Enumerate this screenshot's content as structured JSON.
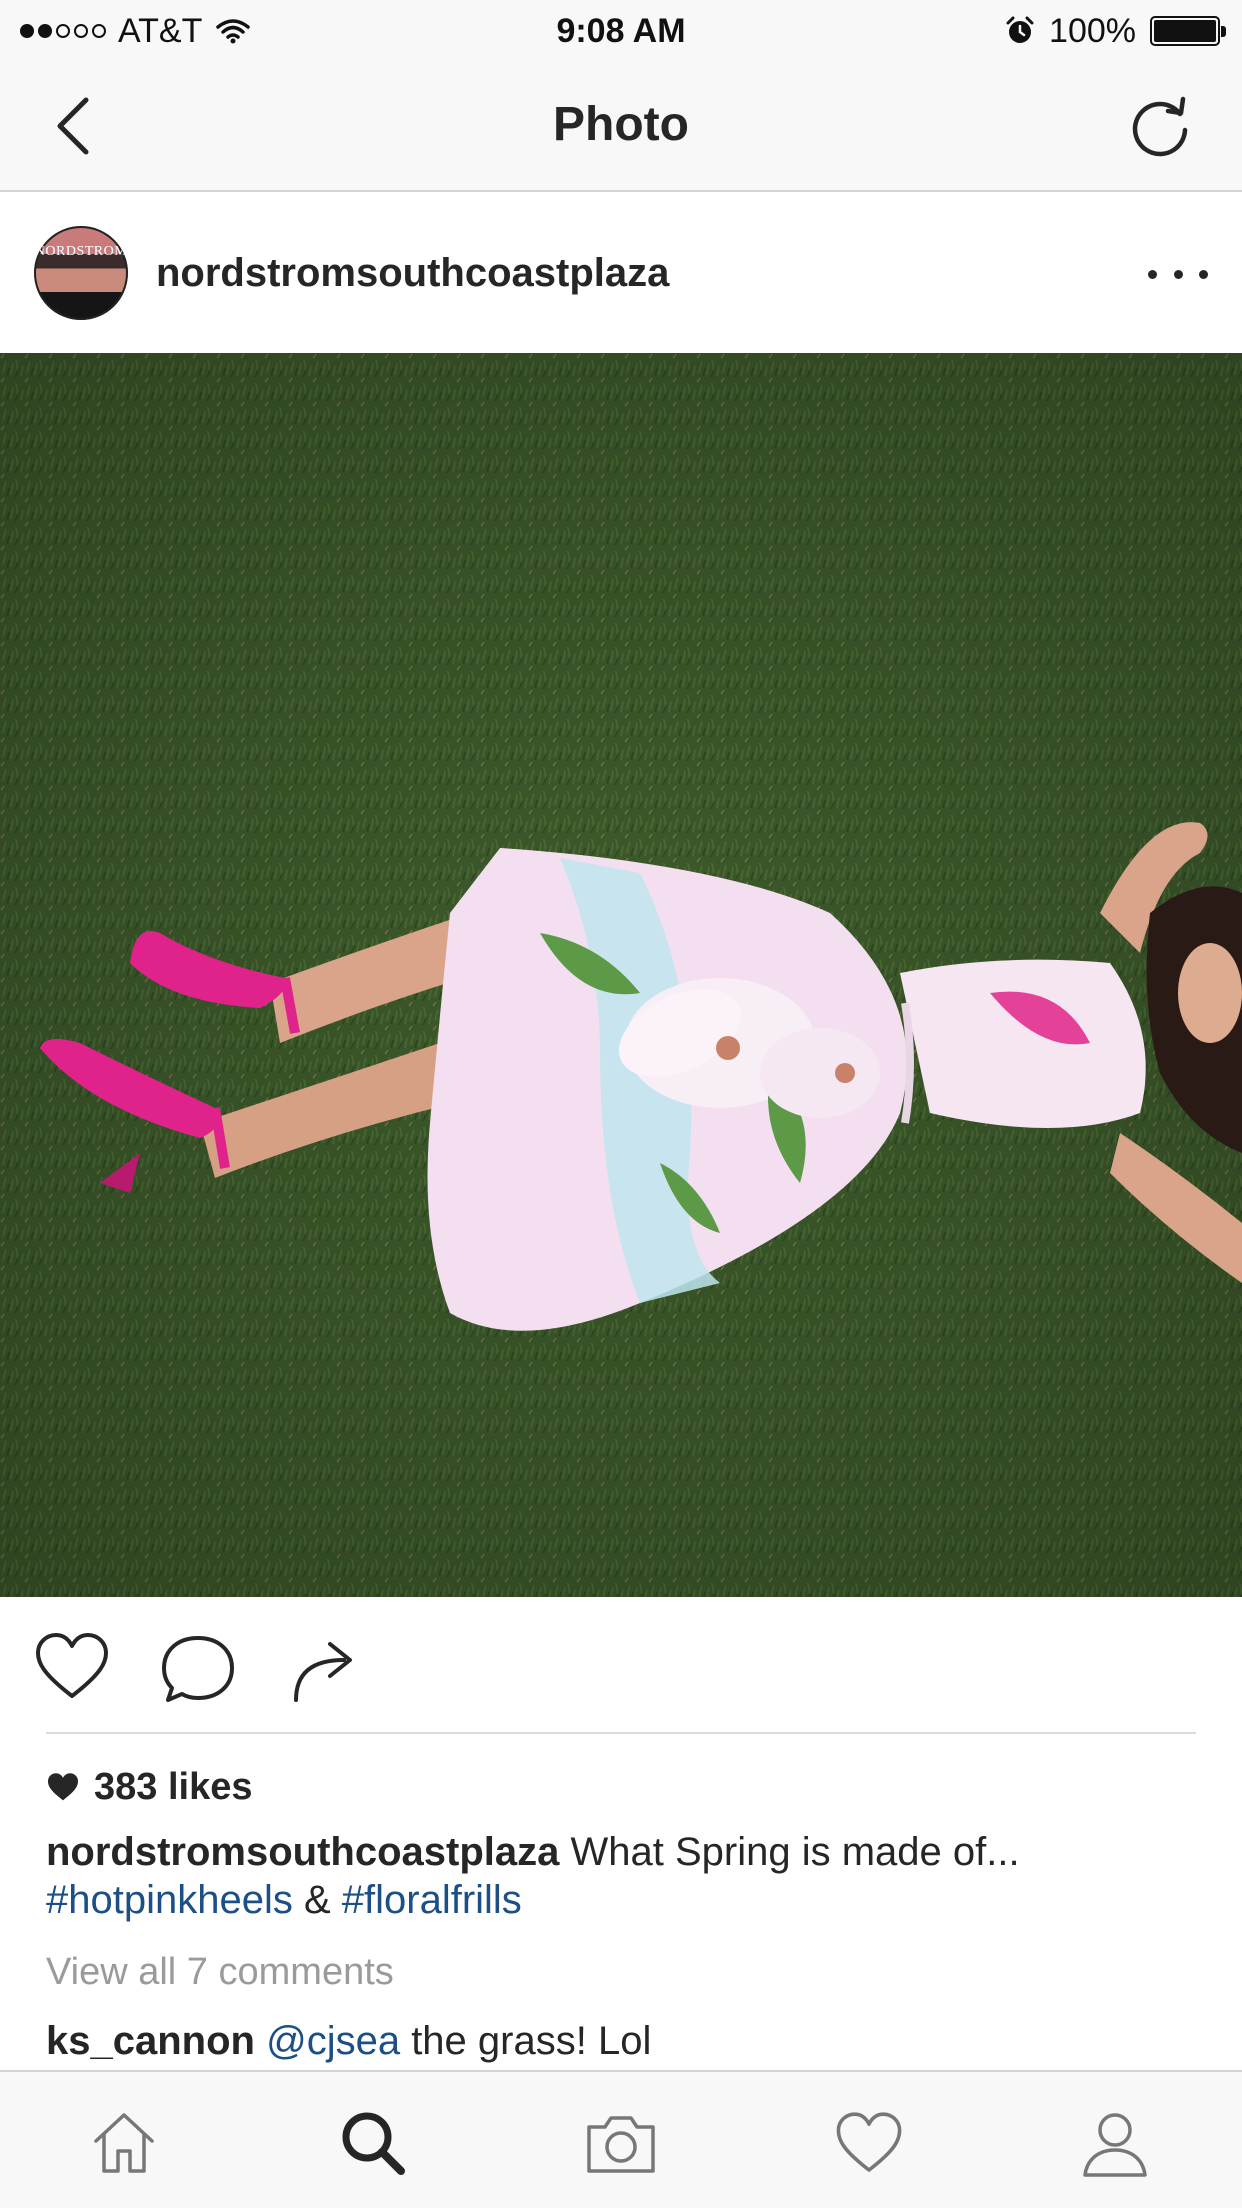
{
  "status_bar": {
    "carrier": "AT&T",
    "time": "9:08 AM",
    "battery": "100%",
    "signal_bars_filled": 2,
    "signal_bars_total": 5
  },
  "nav": {
    "title": "Photo",
    "back_icon": "chevron-left-icon",
    "refresh_icon": "refresh-icon"
  },
  "post": {
    "username": "nordstromsouthcoastplaza",
    "avatar_text": "NORDSTROM",
    "likes": "383 likes",
    "caption": {
      "username": "nordstromsouthcoastplaza",
      "text": " What Spring is made of...",
      "hashtag1": "#hotpinkheels",
      "separator": " & ",
      "hashtag2": "#floralfrills"
    },
    "view_all": "View all 7 comments",
    "comment": {
      "user": "ks_cannon",
      "mention": "@cjsea",
      "text": " the grass! Lol"
    }
  },
  "tabs": [
    {
      "name": "home",
      "icon": "home-icon",
      "active": false
    },
    {
      "name": "search",
      "icon": "search-icon",
      "active": true
    },
    {
      "name": "camera",
      "icon": "camera-icon",
      "active": false
    },
    {
      "name": "activity",
      "icon": "heart-icon",
      "active": false
    },
    {
      "name": "profile",
      "icon": "person-icon",
      "active": false
    }
  ],
  "colors": {
    "hashtag": "#1b4f85",
    "grass": "#3d5a2a",
    "heels": "#e0238a",
    "dress": "#f4dff0"
  }
}
